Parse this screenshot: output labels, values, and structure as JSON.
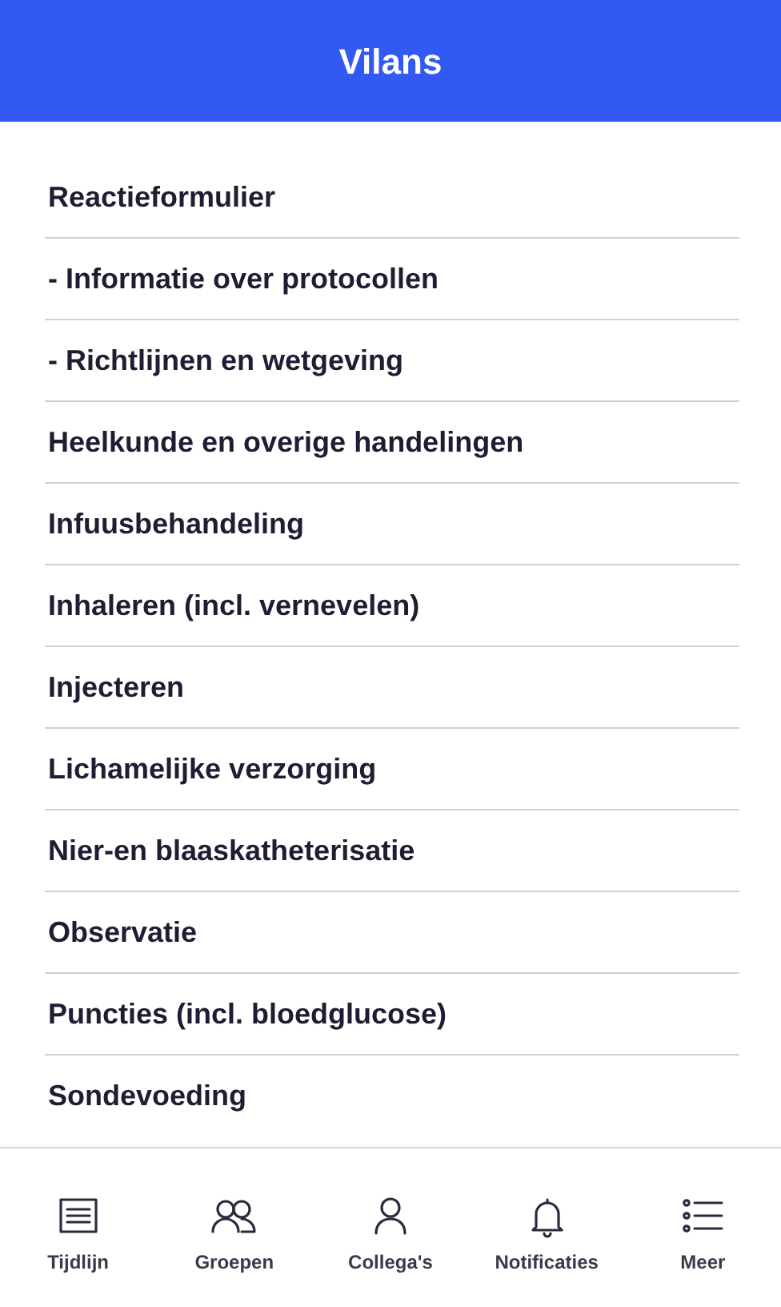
{
  "header": {
    "title": "Vilans"
  },
  "items": [
    "Reactieformulier",
    "- Informatie over protocollen",
    "- Richtlijnen en wetgeving",
    "Heelkunde en overige handelingen",
    "Infuusbehandeling",
    "Inhaleren (incl. vernevelen)",
    "Injecteren",
    "Lichamelijke verzorging",
    "Nier-en blaaskatheterisatie",
    "Observatie",
    "Puncties (incl. bloedglucose)",
    "Sondevoeding"
  ],
  "tab_bar": [
    {
      "label": "Tijdlijn",
      "kind": "timeline"
    },
    {
      "label": "Groepen",
      "kind": "groups"
    },
    {
      "label": "Collega's",
      "kind": "person"
    },
    {
      "label": "Notificaties",
      "kind": "bell"
    },
    {
      "label": "Meer",
      "kind": "more"
    }
  ]
}
